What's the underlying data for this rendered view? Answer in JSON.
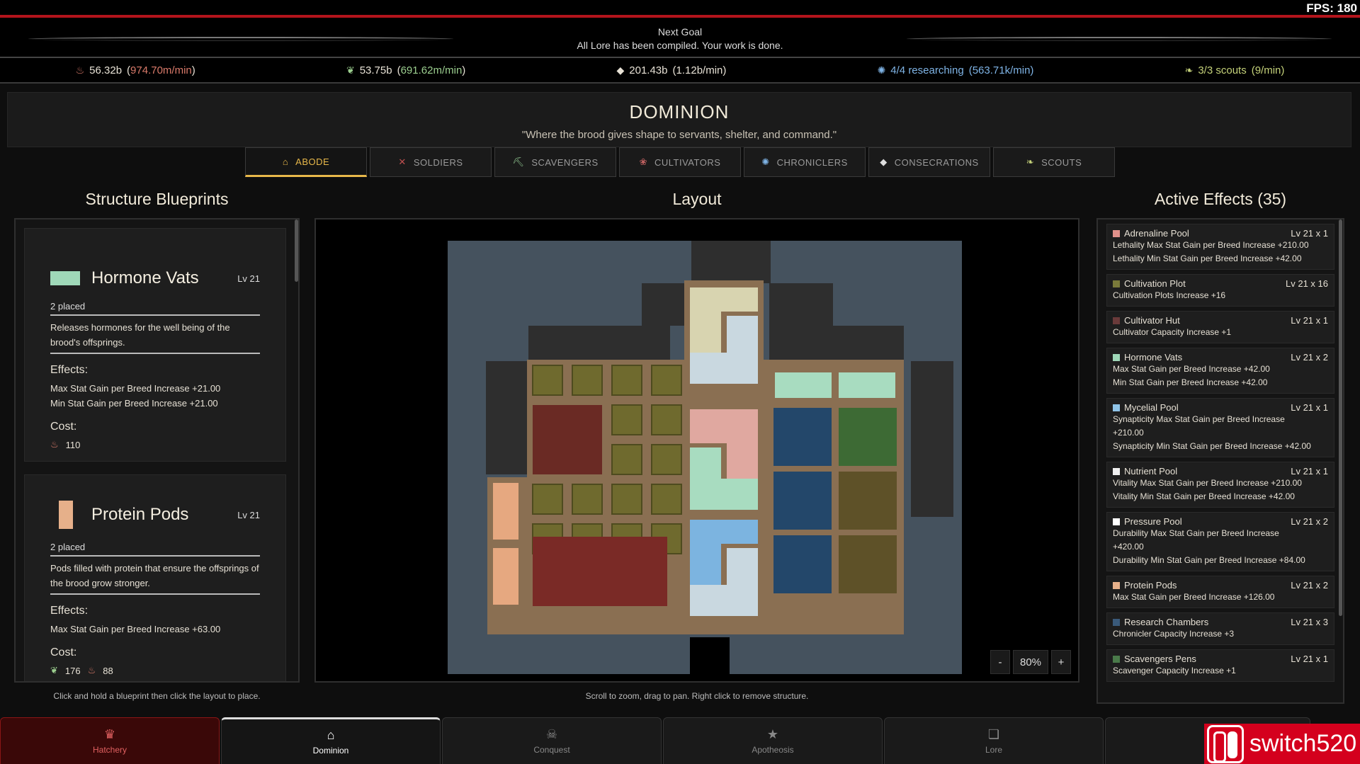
{
  "fps": "FPS: 180",
  "goal": {
    "label": "Next Goal",
    "text": "All Lore has been compiled. Your work is done."
  },
  "resources": [
    {
      "icon": "flame-icon",
      "value": "56.32b",
      "rate": "974.70m/min",
      "color": "#d97a6a"
    },
    {
      "icon": "feather-icon",
      "value": "53.75b",
      "rate": "691.62m/min",
      "color": "#9ccf8f"
    },
    {
      "icon": "drop-icon",
      "value": "201.43b",
      "rate": "1.12b/min",
      "color": "#e8e2d6"
    },
    {
      "icon": "brain-icon",
      "value": "4/4 researching",
      "rate": "563.71k/min",
      "color": "#7fb4e6"
    },
    {
      "icon": "leaf-icon",
      "value": "3/3 scouts",
      "rate": "9/min",
      "color": "#c5d27a"
    }
  ],
  "header": {
    "title": "DOMINION",
    "quote": "\"Where the brood gives shape to servants, shelter, and command.\""
  },
  "tabs": [
    {
      "label": "ABODE",
      "icon": "home-icon",
      "glyph": "⌂"
    },
    {
      "label": "SOLDIERS",
      "icon": "crossed-swords-icon",
      "glyph": "✕"
    },
    {
      "label": "SCAVENGERS",
      "icon": "pickaxe-icon",
      "glyph": "⛏"
    },
    {
      "label": "CULTIVATORS",
      "icon": "sprout-icon",
      "glyph": "❀"
    },
    {
      "label": "CHRONICLERS",
      "icon": "brain-icon",
      "glyph": "✺"
    },
    {
      "label": "CONSECRATIONS",
      "icon": "drop-icon",
      "glyph": "◆"
    },
    {
      "label": "SCOUTS",
      "icon": "leaf-icon",
      "glyph": "❧"
    }
  ],
  "columns": {
    "blueprints": "Structure Blueprints",
    "layout": "Layout",
    "effects": "Active Effects (35)"
  },
  "blueprints": [
    {
      "name": "Hormone Vats",
      "level": "Lv 21",
      "placed": "2 placed",
      "color": "#9fd8b8",
      "desc": "Releases hormones for the well being of the brood's offsprings.",
      "effects_label": "Effects:",
      "effects": [
        "Max Stat Gain per Breed Increase +21.00",
        "Min Stat Gain per Breed Increase +21.00"
      ],
      "cost_label": "Cost:",
      "cost": [
        {
          "icon": "flame-icon",
          "value": "110"
        }
      ]
    },
    {
      "name": "Protein Pods",
      "level": "Lv 21",
      "placed": "2 placed",
      "color": "#e6b08a",
      "desc": "Pods filled with protein that ensure the offsprings of the brood grow stronger.",
      "effects_label": "Effects:",
      "effects": [
        "Max Stat Gain per Breed Increase +63.00"
      ],
      "cost_label": "Cost:",
      "cost": [
        {
          "icon": "feather-icon",
          "value": "176"
        },
        {
          "icon": "flame-icon",
          "value": "88"
        }
      ]
    }
  ],
  "zoom": {
    "minus": "-",
    "level": "80%",
    "plus": "+"
  },
  "effects": [
    {
      "name": "Adrenaline Pool",
      "level": "Lv 21 x 1",
      "color": "#e0908a",
      "lines": [
        "Lethality Max Stat Gain per Breed Increase +210.00",
        "Lethality Min Stat Gain per Breed Increase +42.00"
      ]
    },
    {
      "name": "Cultivation Plot",
      "level": "Lv 21 x 16",
      "color": "#7a7a3a",
      "lines": [
        "Cultivation Plots Increase +16"
      ]
    },
    {
      "name": "Cultivator Hut",
      "level": "Lv 21 x 1",
      "color": "#6a3a3a",
      "lines": [
        "Cultivator Capacity Increase +1"
      ]
    },
    {
      "name": "Hormone Vats",
      "level": "Lv 21 x 2",
      "color": "#9fd8b8",
      "lines": [
        "Max Stat Gain per Breed Increase +42.00",
        "Min Stat Gain per Breed Increase +42.00"
      ]
    },
    {
      "name": "Mycelial Pool",
      "level": "Lv 21 x 1",
      "color": "#8fc4e8",
      "lines": [
        "Synapticity Max Stat Gain per Breed Increase",
        "+210.00",
        "Synapticity Min Stat Gain per Breed Increase +42.00"
      ]
    },
    {
      "name": "Nutrient Pool",
      "level": "Lv 21 x 1",
      "color": "#f0f0f0",
      "lines": [
        "Vitality Max Stat Gain per Breed Increase +210.00",
        "Vitality Min Stat Gain per Breed Increase +42.00"
      ]
    },
    {
      "name": "Pressure Pool",
      "level": "Lv 21 x 2",
      "color": "#ffffff",
      "lines": [
        "Durability Max Stat Gain per Breed Increase",
        "+420.00",
        "Durability Min Stat Gain per Breed Increase +84.00"
      ]
    },
    {
      "name": "Protein Pods",
      "level": "Lv 21 x 2",
      "color": "#e6b08a",
      "lines": [
        "Max Stat Gain per Breed Increase +126.00"
      ]
    },
    {
      "name": "Research Chambers",
      "level": "Lv 21 x 3",
      "color": "#3a5a7a",
      "lines": [
        "Chronicler Capacity Increase +3"
      ]
    },
    {
      "name": "Scavengers Pens",
      "level": "Lv 21 x 1",
      "color": "#4a7a4a",
      "lines": [
        "Scavenger Capacity Increase +1"
      ]
    }
  ],
  "hints": {
    "left": "Click and hold a blueprint then click the layout to place.",
    "mid": "Scroll to zoom, drag to pan. Right click to remove structure."
  },
  "bottom_tabs": [
    {
      "label": "Hatchery",
      "icon": "crown-icon",
      "glyph": "♛"
    },
    {
      "label": "Dominion",
      "icon": "home-icon",
      "glyph": "⌂"
    },
    {
      "label": "Conquest",
      "icon": "skull-icon",
      "glyph": "☠"
    },
    {
      "label": "Apotheosis",
      "icon": "star-icon",
      "glyph": "★"
    },
    {
      "label": "Lore",
      "icon": "scroll-icon",
      "glyph": "❏"
    },
    {
      "label": "",
      "icon": "gear-icon",
      "glyph": ""
    }
  ],
  "watermark": "switch520"
}
